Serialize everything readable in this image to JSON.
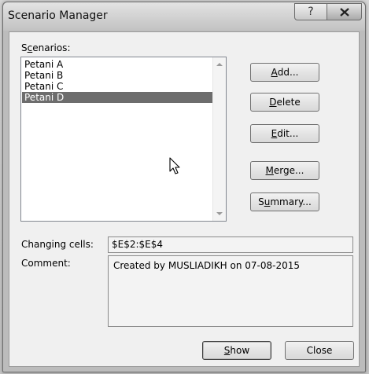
{
  "window": {
    "title": "Scenario Manager",
    "help_glyph": "?",
    "close_icon": "close-icon"
  },
  "scenarios": {
    "label_pre": "S",
    "label_ul": "c",
    "label_post": "enarios:",
    "items": [
      "Petani A",
      "Petani B",
      "Petani C",
      "Petani D"
    ],
    "selected": "Petani D"
  },
  "buttons": {
    "add": {
      "ul": "A",
      "post": "dd..."
    },
    "delete": {
      "ul": "D",
      "post": "elete"
    },
    "edit": {
      "ul": "E",
      "post": "dit..."
    },
    "merge": {
      "ul": "M",
      "post": "erge..."
    },
    "summary": {
      "pre": "S",
      "ul": "u",
      "post": "mmary..."
    },
    "show": {
      "ul": "S",
      "post": "how"
    },
    "close": "Close"
  },
  "changing_cells": {
    "label": "Changing cells:",
    "value": "$E$2:$E$4"
  },
  "comment": {
    "label": "Comment:",
    "value": "Created by MUSLIADIKH on 07-08-2015"
  },
  "colors": {
    "selection": "#6d6d6d",
    "dialog_bg": "#f0f0f0"
  }
}
